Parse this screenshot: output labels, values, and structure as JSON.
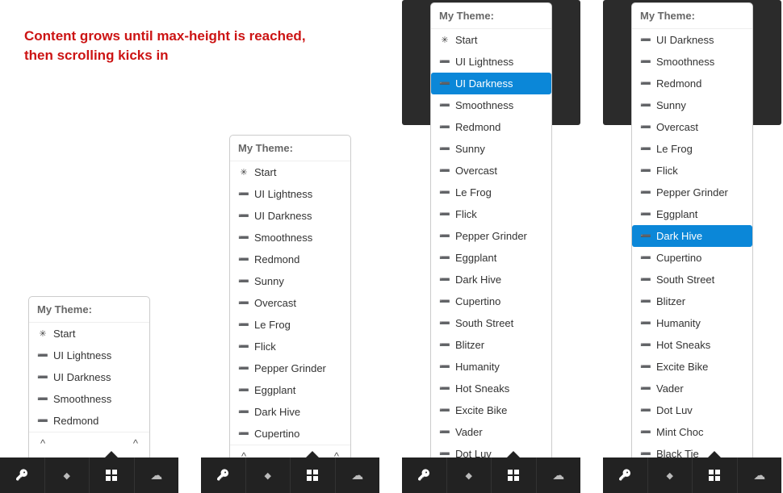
{
  "caption": "Content grows until max-height is reached, then scrolling kicks in",
  "header_label": "My Theme:",
  "themes_short": [
    "Start",
    "UI Lightness",
    "UI Darkness",
    "Smoothness",
    "Redmond"
  ],
  "themes_mid": [
    "Start",
    "UI Lightness",
    "UI Darkness",
    "Smoothness",
    "Redmond",
    "Sunny",
    "Overcast",
    "Le Frog",
    "Flick",
    "Pepper Grinder",
    "Eggplant",
    "Dark Hive",
    "Cupertino"
  ],
  "themes_long": [
    "Start",
    "UI Lightness",
    "UI Darkness",
    "Smoothness",
    "Redmond",
    "Sunny",
    "Overcast",
    "Le Frog",
    "Flick",
    "Pepper Grinder",
    "Eggplant",
    "Dark Hive",
    "Cupertino",
    "South Street",
    "Blitzer",
    "Humanity",
    "Hot Sneaks",
    "Excite Bike",
    "Vader",
    "Dot Luv"
  ],
  "themes_scrolled": [
    "UI Darkness",
    "Smoothness",
    "Redmond",
    "Sunny",
    "Overcast",
    "Le Frog",
    "Flick",
    "Pepper Grinder",
    "Eggplant",
    "Dark Hive",
    "Cupertino",
    "South Street",
    "Blitzer",
    "Humanity",
    "Hot Sneaks",
    "Excite Bike",
    "Vader",
    "Dot Luv",
    "Mint Choc",
    "Black Tie"
  ],
  "active_in_panel3": "UI Darkness",
  "active_in_panel4": "Dark Hive",
  "footer_chevrons": {
    "left": "^",
    "right": "^"
  },
  "nav_icons": [
    "key",
    "drop",
    "grid",
    "cloud"
  ],
  "nav_active_index": 2
}
